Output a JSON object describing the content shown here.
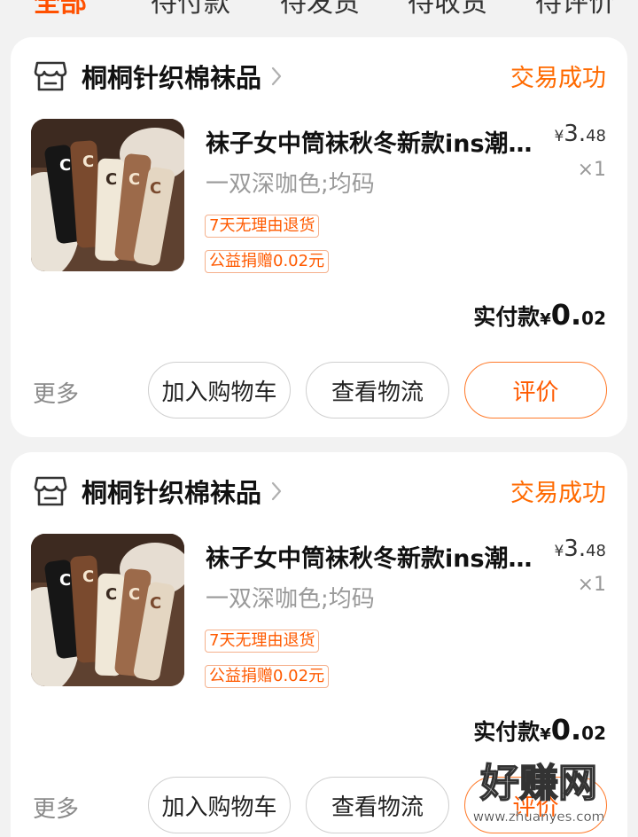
{
  "tabs": [
    {
      "label": "全部",
      "active": true
    },
    {
      "label": "待付款"
    },
    {
      "label": "待发货"
    },
    {
      "label": "待收货"
    },
    {
      "label": "待评价"
    }
  ],
  "orders": [
    {
      "shop_name": "桐桐针织棉袜品",
      "status": "交易成功",
      "product_title": "袜子女中筒袜秋冬新款ins潮外...",
      "price_symbol": "¥",
      "price_int": "3.",
      "price_dec": "48",
      "sku": "一双深咖色;均码",
      "quantity": "×1",
      "tags": [
        "7天无理由退货",
        "公益捐赠0.02元"
      ],
      "paid_label": "实付款",
      "paid_symbol": "¥",
      "paid_int": "0.",
      "paid_dec": "02",
      "more_label": "更多",
      "buttons": {
        "add_cart": "加入购物车",
        "logistics": "查看物流",
        "review": "评价"
      }
    },
    {
      "shop_name": "桐桐针织棉袜品",
      "status": "交易成功",
      "product_title": "袜子女中筒袜秋冬新款ins潮外...",
      "price_symbol": "¥",
      "price_int": "3.",
      "price_dec": "48",
      "sku": "一双深咖色;均码",
      "quantity": "×1",
      "tags": [
        "7天无理由退货",
        "公益捐赠0.02元"
      ],
      "paid_label": "实付款",
      "paid_symbol": "¥",
      "paid_int": "0.",
      "paid_dec": "02",
      "more_label": "更多",
      "buttons": {
        "add_cart": "加入购物车",
        "logistics": "查看物流",
        "review": "评价"
      }
    }
  ],
  "watermark": {
    "main": "好赚网",
    "url": "www.zhuanyes.com"
  },
  "colors": {
    "accent": "#ff5000",
    "status": "#ff6a00",
    "background": "#f2f2f2"
  }
}
